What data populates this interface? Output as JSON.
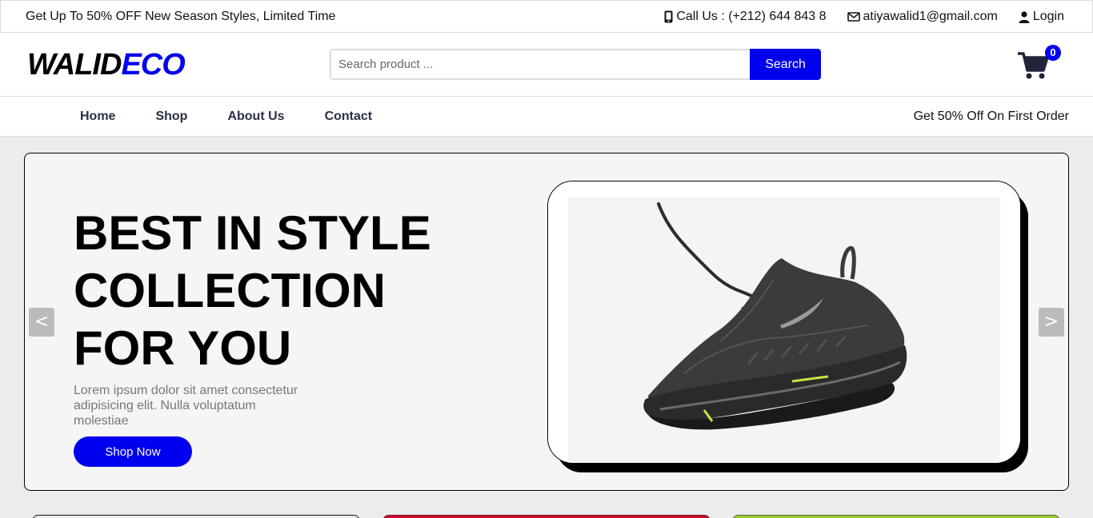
{
  "topbar": {
    "promo": "Get Up To 50% OFF New Season Styles, Limited Time",
    "phone": "Call Us : (+212) 644 843 8",
    "email": "atiyawalid1@gmail.com",
    "login": "Login",
    "icons": [
      "mobile-phone-icon",
      "envelope-icon",
      "user-icon"
    ]
  },
  "header": {
    "logo_part1": "WALID",
    "logo_part2": "ECO",
    "search_placeholder": "Search product ...",
    "search_button": "Search",
    "cart_count": "0",
    "colors": {
      "accent": "#0000ee",
      "cart": "#23243b"
    }
  },
  "nav": {
    "links": [
      "Home",
      "Shop",
      "About Us",
      "Contact"
    ],
    "offer": "Get 50% Off On First Order"
  },
  "hero": {
    "title_lines": [
      "BEST IN STYLE",
      "COLLECTION",
      "FOR YOU"
    ],
    "description": "Lorem ipsum dolor sit amet consectetur adipisicing elit. Nulla voluptatum molestiae",
    "button": "Shop Now",
    "prev": "<",
    "next": ">",
    "image": "black-running-shoe"
  },
  "cards": [
    {
      "border_color": "#111111"
    },
    {
      "border_color": "#c8102e"
    },
    {
      "border_color": "#9acd32"
    }
  ]
}
